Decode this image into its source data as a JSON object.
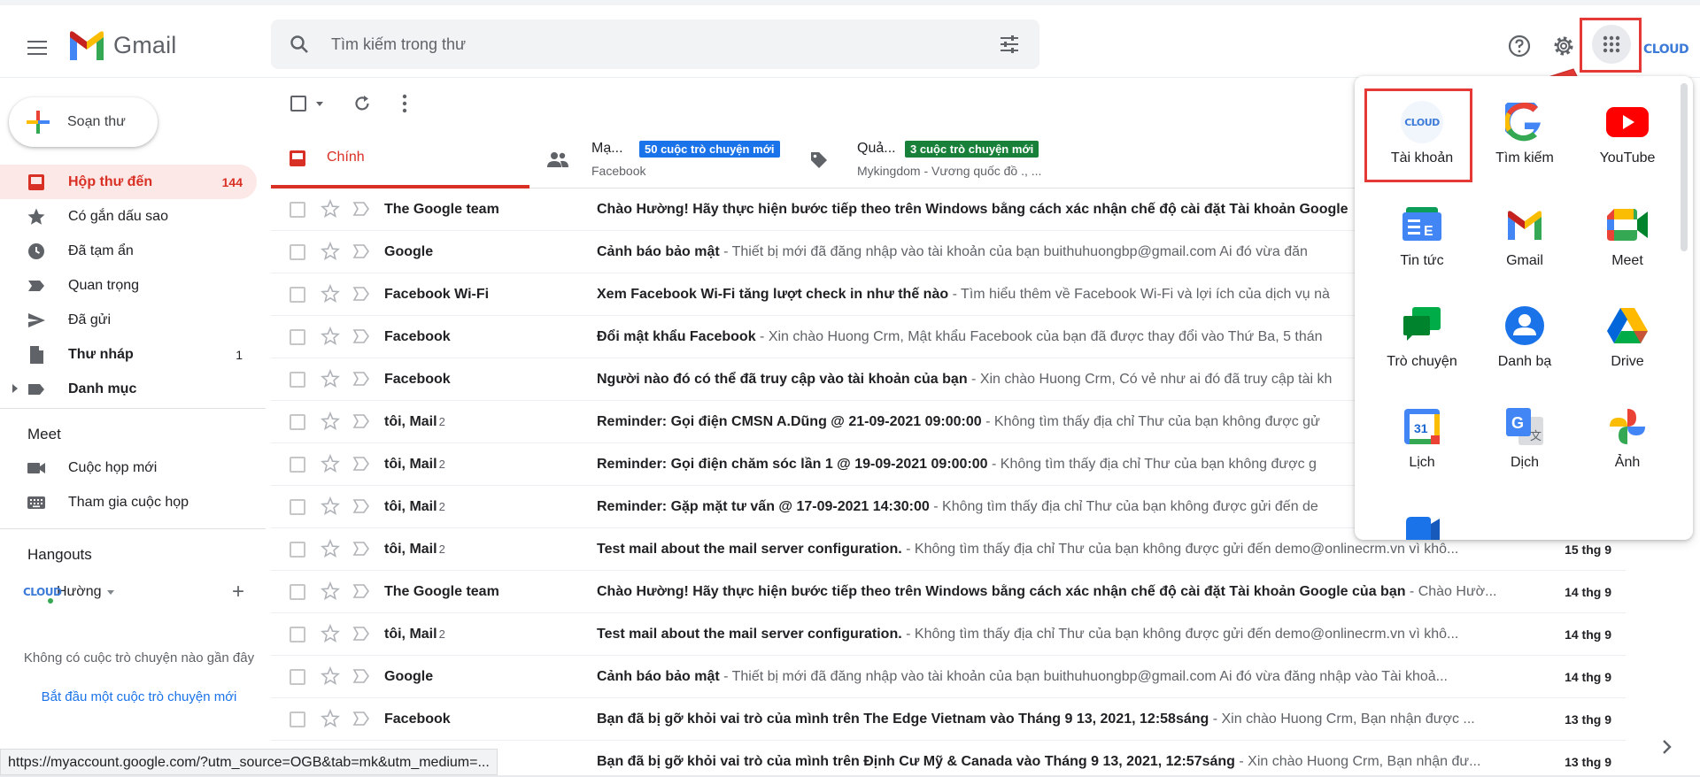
{
  "header": {
    "logo_text": "Gmail",
    "search_placeholder": "Tìm kiếm trong thư",
    "cloud_text": "CLOUD"
  },
  "sidebar": {
    "compose_label": "Soạn thư",
    "items": [
      {
        "label": "Hộp thư đến",
        "count": "144"
      },
      {
        "label": "Có gắn dấu sao",
        "count": ""
      },
      {
        "label": "Đã tạm ẩn",
        "count": ""
      },
      {
        "label": "Quan trọng",
        "count": ""
      },
      {
        "label": "Đã gửi",
        "count": ""
      },
      {
        "label": "Thư nháp",
        "count": "1"
      },
      {
        "label": "Danh mục",
        "count": ""
      }
    ],
    "meet_title": "Meet",
    "meet_items": [
      "Cuộc họp mới",
      "Tham gia cuộc họp"
    ],
    "hangouts_title": "Hangouts",
    "hangouts_user": "Hường",
    "empty_msg": "Không có cuộc trò chuyện nào gần đây",
    "empty_link": "Bắt đầu một cuộc trò chuyện mới"
  },
  "tabs": {
    "primary": "Chính",
    "social": {
      "label": "Mạ...",
      "badge": "50 cuộc trò chuyện mới",
      "sub": "Facebook"
    },
    "promo": {
      "label": "Quả...",
      "badge": "3 cuộc trò chuyện mới",
      "sub": "Mykingdom - Vương quốc đồ ., ..."
    }
  },
  "emails": [
    {
      "from": "The Google team",
      "num": "",
      "subject": "Chào Hường! Hãy thực hiện bước tiếp theo trên Windows bằng cách xác nhận chế độ cài đặt Tài khoản Google",
      "snippet": "",
      "date": ""
    },
    {
      "from": "Google",
      "num": "",
      "subject": "Cảnh báo bảo mật",
      "snippet": " - Thiết bị mới đã đăng nhập vào tài khoản của bạn buithuhuongbp@gmail.com Ai đó vừa đăn",
      "date": ""
    },
    {
      "from": "Facebook Wi-Fi",
      "num": "",
      "subject": "Xem Facebook Wi-Fi tăng lượt check in như thế nào",
      "snippet": " - Tìm hiểu thêm về Facebook Wi-Fi và lợi ích của dịch vụ nà",
      "date": ""
    },
    {
      "from": "Facebook",
      "num": "",
      "subject": "Đổi mật khẩu Facebook",
      "snippet": " - Xin chào Huong Crm, Mật khẩu Facebook của bạn đã được thay đổi vào Thứ Ba, 5 thán",
      "date": ""
    },
    {
      "from": "Facebook",
      "num": "",
      "subject": "Người nào đó có thể đã truy cập vào tài khoản của bạn",
      "snippet": " - Xin chào Huong Crm, Có vẻ như ai đó đã truy cập tài kh",
      "date": ""
    },
    {
      "from": "tôi, Mail",
      "num": "2",
      "subject": "Reminder: Gọi điện CMSN A.Dũng @ 21-09-2021 09:00:00",
      "snippet": " - Không tìm thấy địa chỉ Thư của bạn không được gử",
      "date": ""
    },
    {
      "from": "tôi, Mail",
      "num": "2",
      "subject": "Reminder: Gọi điện chăm sóc lần 1 @ 19-09-2021 09:00:00",
      "snippet": " - Không tìm thấy địa chỉ Thư của bạn không được g",
      "date": ""
    },
    {
      "from": "tôi, Mail",
      "num": "2",
      "subject": "Reminder: Gặp mặt tư vấn @ 17-09-2021 14:30:00",
      "snippet": " - Không tìm thấy địa chỉ Thư của bạn không được gửi đến de",
      "date": ""
    },
    {
      "from": "tôi, Mail",
      "num": "2",
      "subject": "Test mail about the mail server configuration.",
      "snippet": " - Không tìm thấy địa chỉ Thư của bạn không được gửi đến demo@onlinecrm.vn vì khô...",
      "date": "15 thg 9"
    },
    {
      "from": "The Google team",
      "num": "",
      "subject": "Chào Hường! Hãy thực hiện bước tiếp theo trên Windows bằng cách xác nhận chế độ cài đặt Tài khoản Google của bạn",
      "snippet": " - Chào Hườ...",
      "date": "14 thg 9"
    },
    {
      "from": "tôi, Mail",
      "num": "2",
      "subject": "Test mail about the mail server configuration.",
      "snippet": " - Không tìm thấy địa chỉ Thư của bạn không được gửi đến demo@onlinecrm.vn vì khô...",
      "date": "14 thg 9"
    },
    {
      "from": "Google",
      "num": "",
      "subject": "Cảnh báo bảo mật",
      "snippet": " - Thiết bị mới đã đăng nhập vào tài khoản của bạn buithuhuongbp@gmail.com Ai đó vừa đăng nhập vào Tài khoả...",
      "date": "14 thg 9"
    },
    {
      "from": "Facebook",
      "num": "",
      "subject": "Bạn đã bị gỡ khỏi vai trò của mình trên The Edge Vietnam vào Tháng 9 13, 2021, 12:58sáng",
      "snippet": " - Xin chào Huong Crm, Bạn nhận được ...",
      "date": "13 thg 9"
    },
    {
      "from": "Facebook",
      "num": "",
      "subject": "Bạn đã bị gỡ khỏi vai trò của mình trên Định Cư Mỹ & Canada vào Tháng 9 13, 2021, 12:57sáng",
      "snippet": " - Xin chào Huong Crm, Bạn nhận đư...",
      "date": "13 thg 9"
    }
  ],
  "apps": [
    {
      "name": "Tài khoản"
    },
    {
      "name": "Tìm kiếm"
    },
    {
      "name": "YouTube"
    },
    {
      "name": "Tin tức"
    },
    {
      "name": "Gmail"
    },
    {
      "name": "Meet"
    },
    {
      "name": "Trò chuyện"
    },
    {
      "name": "Danh bạ"
    },
    {
      "name": "Drive"
    },
    {
      "name": "Lịch"
    },
    {
      "name": "Dịch"
    },
    {
      "name": "Ảnh"
    }
  ],
  "calendar_day": "31",
  "status_url": "https://myaccount.google.com/?utm_source=OGB&tab=mk&utm_medium=...",
  "colors": {
    "accent_red": "#d93025",
    "badge_blue": "#1a73e8",
    "badge_green": "#188038",
    "highlight": "#e53935"
  }
}
